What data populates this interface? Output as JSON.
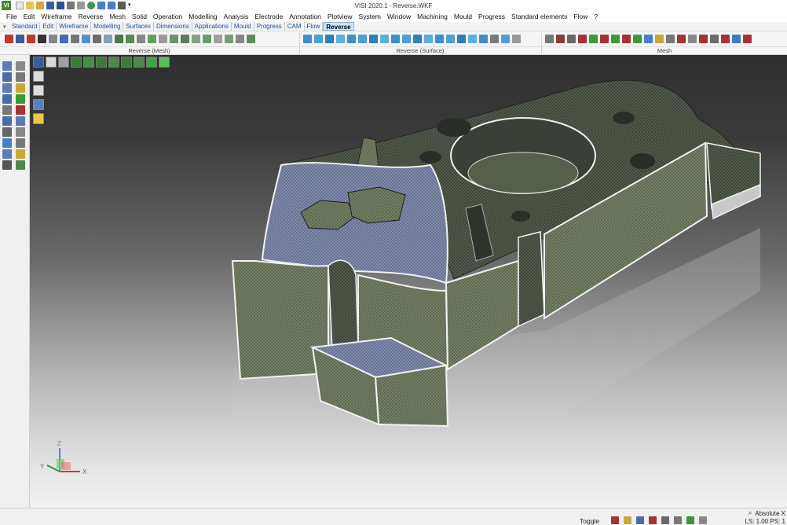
{
  "window": {
    "title": "VISI 2020.1 - Reverse.WKF",
    "logo": "VI"
  },
  "menu": [
    "File",
    "Edit",
    "Wireframe",
    "Reverse",
    "Mesh",
    "Solid",
    "Operation",
    "Modelling",
    "Analysis",
    "Electrode",
    "Annotation",
    "Plotview",
    "System",
    "Window",
    "Machining",
    "Mould",
    "Progress",
    "Standard elements",
    "Flow",
    "?"
  ],
  "tabs": [
    "Standard",
    "Edit",
    "Wireframe",
    "Modelling",
    "Surfaces",
    "Dimensions",
    "Applications",
    "Mould",
    "Progress",
    "CAM",
    "Flow",
    "Reverse"
  ],
  "active_tab": "Reverse",
  "toolbar_groups": [
    "Reverse (Mesh)",
    "Reverse (Surface)",
    "Mesh"
  ],
  "status": {
    "toggle_label": "Toggle",
    "absolute_label": "Absolute X",
    "ls_text": "LS: 1.00 PS: 1"
  },
  "axis": {
    "x": "X",
    "y": "Y",
    "z": "Z"
  },
  "colors": {
    "mesh_green": "#5f6b52",
    "mesh_blue": "#6d7596",
    "edge_white": "#f4f4f4"
  }
}
